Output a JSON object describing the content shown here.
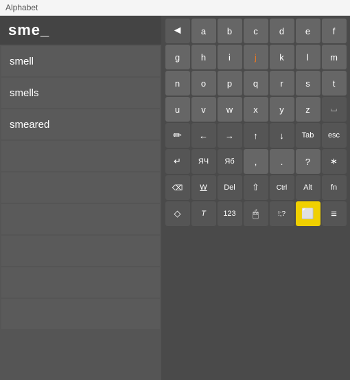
{
  "topbar": {
    "title": "Alphabet"
  },
  "search": {
    "query": "sme_"
  },
  "suggestions": [
    {
      "text": "smell",
      "empty": false
    },
    {
      "text": "smells",
      "empty": false
    },
    {
      "text": "smeared",
      "empty": false
    },
    {
      "text": "",
      "empty": true
    },
    {
      "text": "",
      "empty": true
    },
    {
      "text": "",
      "empty": true
    },
    {
      "text": "",
      "empty": true
    },
    {
      "text": "",
      "empty": true
    },
    {
      "text": "",
      "empty": true
    }
  ],
  "keyboard": {
    "rows": [
      [
        "◄",
        "a",
        "b",
        "c",
        "d",
        "e",
        "f"
      ],
      [
        "g",
        "h",
        "i",
        "j",
        "k",
        "l",
        "m"
      ],
      [
        "n",
        "o",
        "p",
        "q",
        "r",
        "s",
        "t"
      ],
      [
        "u",
        "v",
        "w",
        "x",
        "y",
        "z",
        "⌴"
      ],
      [
        "✏",
        "←",
        "→",
        "↑",
        "↓",
        "Tab",
        "esc"
      ],
      [
        "↵",
        "ЯЧ",
        "Яб",
        ",",
        ".",
        "?",
        "∗"
      ],
      [
        "⌫✕",
        "W̲",
        "⌦",
        "↑",
        "Ctrl",
        "Alt",
        "fn"
      ],
      [
        "◇",
        "𝒯",
        "123",
        "🖱",
        "!;?",
        "⬜",
        "≡"
      ]
    ]
  }
}
